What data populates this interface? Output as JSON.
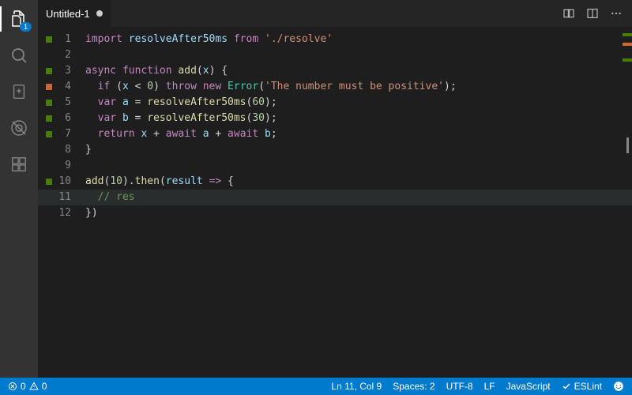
{
  "activitybar": {
    "explorer_badge": "1"
  },
  "tab": {
    "title": "Untitled-1"
  },
  "gutter": {
    "lines": [
      "1",
      "2",
      "3",
      "4",
      "5",
      "6",
      "7",
      "8",
      "9",
      "10",
      "11",
      "12"
    ],
    "marks": {
      "0": "green",
      "2": "green",
      "3": "orange",
      "4": "green",
      "5": "green",
      "6": "green",
      "9": "green"
    }
  },
  "code": {
    "lines": [
      [
        {
          "c": "tok-key",
          "t": "import"
        },
        {
          "c": "tok-plain",
          "t": " "
        },
        {
          "c": "tok-ident",
          "t": "resolveAfter50ms"
        },
        {
          "c": "tok-plain",
          "t": " "
        },
        {
          "c": "tok-key",
          "t": "from"
        },
        {
          "c": "tok-plain",
          "t": " "
        },
        {
          "c": "tok-str",
          "t": "'./resolve'"
        }
      ],
      [],
      [
        {
          "c": "tok-key",
          "t": "async"
        },
        {
          "c": "tok-plain",
          "t": " "
        },
        {
          "c": "tok-key",
          "t": "function"
        },
        {
          "c": "tok-plain",
          "t": " "
        },
        {
          "c": "tok-fn",
          "t": "add"
        },
        {
          "c": "tok-plain",
          "t": "("
        },
        {
          "c": "tok-ident",
          "t": "x"
        },
        {
          "c": "tok-plain",
          "t": ") {"
        }
      ],
      [
        {
          "c": "tok-plain",
          "t": "  "
        },
        {
          "c": "tok-key",
          "t": "if"
        },
        {
          "c": "tok-plain",
          "t": " ("
        },
        {
          "c": "tok-ident",
          "t": "x"
        },
        {
          "c": "tok-plain",
          "t": " < "
        },
        {
          "c": "tok-num",
          "t": "0"
        },
        {
          "c": "tok-plain",
          "t": ") "
        },
        {
          "c": "tok-key",
          "t": "throw"
        },
        {
          "c": "tok-plain",
          "t": " "
        },
        {
          "c": "tok-key",
          "t": "new"
        },
        {
          "c": "tok-plain",
          "t": " "
        },
        {
          "c": "tok-type",
          "t": "Error"
        },
        {
          "c": "tok-plain",
          "t": "("
        },
        {
          "c": "tok-str",
          "t": "'The number must be positive'"
        },
        {
          "c": "tok-plain",
          "t": ");"
        }
      ],
      [
        {
          "c": "tok-plain",
          "t": "  "
        },
        {
          "c": "tok-key",
          "t": "var"
        },
        {
          "c": "tok-plain",
          "t": " "
        },
        {
          "c": "tok-ident",
          "t": "a"
        },
        {
          "c": "tok-plain",
          "t": " = "
        },
        {
          "c": "tok-fn",
          "t": "resolveAfter50ms"
        },
        {
          "c": "tok-plain",
          "t": "("
        },
        {
          "c": "tok-num",
          "t": "60"
        },
        {
          "c": "tok-plain",
          "t": ");"
        }
      ],
      [
        {
          "c": "tok-plain",
          "t": "  "
        },
        {
          "c": "tok-key",
          "t": "var"
        },
        {
          "c": "tok-plain",
          "t": " "
        },
        {
          "c": "tok-ident",
          "t": "b"
        },
        {
          "c": "tok-plain",
          "t": " = "
        },
        {
          "c": "tok-fn",
          "t": "resolveAfter50ms"
        },
        {
          "c": "tok-plain",
          "t": "("
        },
        {
          "c": "tok-num",
          "t": "30"
        },
        {
          "c": "tok-plain",
          "t": ");"
        }
      ],
      [
        {
          "c": "tok-plain",
          "t": "  "
        },
        {
          "c": "tok-key",
          "t": "return"
        },
        {
          "c": "tok-plain",
          "t": " "
        },
        {
          "c": "tok-ident",
          "t": "x"
        },
        {
          "c": "tok-plain",
          "t": " + "
        },
        {
          "c": "tok-key",
          "t": "await"
        },
        {
          "c": "tok-plain",
          "t": " "
        },
        {
          "c": "tok-ident",
          "t": "a"
        },
        {
          "c": "tok-plain",
          "t": " + "
        },
        {
          "c": "tok-key",
          "t": "await"
        },
        {
          "c": "tok-plain",
          "t": " "
        },
        {
          "c": "tok-ident",
          "t": "b"
        },
        {
          "c": "tok-plain",
          "t": ";"
        }
      ],
      [
        {
          "c": "tok-plain",
          "t": "}"
        }
      ],
      [],
      [
        {
          "c": "tok-fn",
          "t": "add"
        },
        {
          "c": "tok-plain",
          "t": "("
        },
        {
          "c": "tok-num",
          "t": "10"
        },
        {
          "c": "tok-plain",
          "t": ")."
        },
        {
          "c": "tok-fn",
          "t": "then"
        },
        {
          "c": "tok-plain",
          "t": "("
        },
        {
          "c": "tok-ident",
          "t": "result"
        },
        {
          "c": "tok-plain",
          "t": " "
        },
        {
          "c": "tok-key",
          "t": "=>"
        },
        {
          "c": "tok-plain",
          "t": " {"
        }
      ],
      [
        {
          "c": "tok-plain",
          "t": "  "
        },
        {
          "c": "tok-cmt",
          "t": "// res"
        }
      ],
      [
        {
          "c": "tok-plain",
          "t": "})"
        }
      ]
    ],
    "current_line": 10
  },
  "status": {
    "errors": "0",
    "warnings": "0",
    "cursor": "Ln 11, Col 9",
    "spaces": "Spaces: 2",
    "encoding": "UTF-8",
    "eol": "LF",
    "lang": "JavaScript",
    "eslint": "ESLint"
  }
}
